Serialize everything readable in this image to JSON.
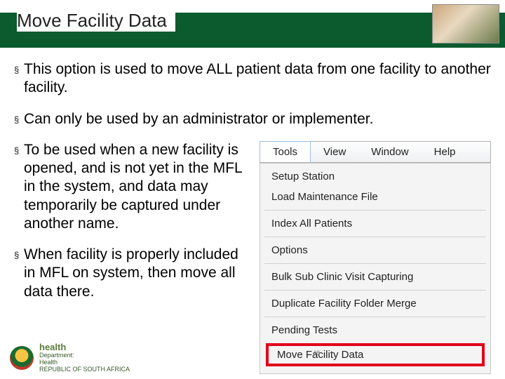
{
  "header": {
    "title": "Move Facility Data"
  },
  "bullets": {
    "b1": "This option is used to move ALL patient data from one facility to another facility.",
    "b2": "Can only be used by an administrator or implementer.",
    "b3": "To be used when a new facility is opened, and is not yet in the MFL in the system, and data may temporarily be captured under another name.",
    "b4": "When facility is properly included in MFL on system, then move all data there."
  },
  "menubar": {
    "tools": "Tools",
    "view": "View",
    "window": "Window",
    "help": "Help"
  },
  "dropdown": {
    "setup_station": "Setup Station",
    "load_maintenance": "Load Maintenance File",
    "index_all": "Index All Patients",
    "options": "Options",
    "bulk_sub": "Bulk Sub Clinic Visit Capturing",
    "duplicate_merge": "Duplicate Facility Folder Merge",
    "pending_tests": "Pending Tests",
    "move_facility": "Move Facility Data"
  },
  "footer": {
    "health": "health",
    "line1": "Department:",
    "line2": "Health",
    "line3": "REPUBLIC OF SOUTH AFRICA",
    "pagenum": "48"
  }
}
